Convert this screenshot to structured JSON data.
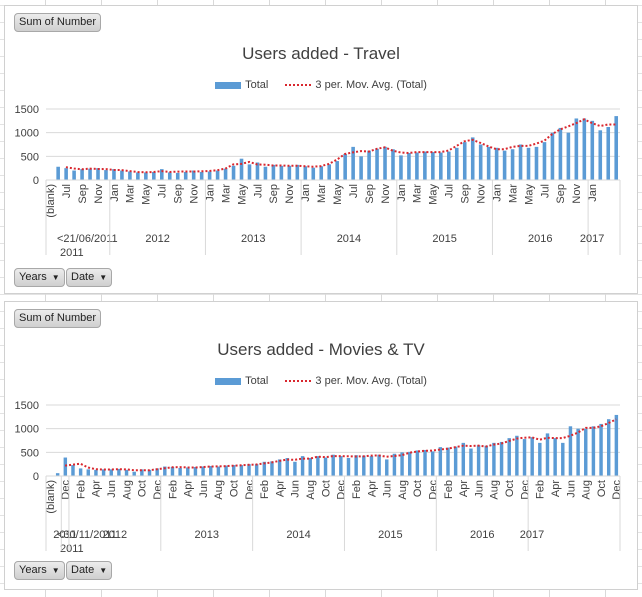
{
  "chart_data": [
    {
      "type": "bar",
      "title": "Users added - Travel",
      "field_button": "Sum of Number",
      "axis_buttons": [
        {
          "label": "Years"
        },
        {
          "label": "Date"
        }
      ],
      "legend": {
        "position": "top",
        "entries": [
          "Total",
          "3 per. Mov. Avg. (Total)"
        ]
      },
      "ylim": [
        0,
        1500
      ],
      "yticks": [
        "0",
        "500",
        "1000",
        "1500"
      ],
      "grid": true,
      "colors": {
        "bar": "#5b9bd5",
        "trend": "#d9272e"
      },
      "month_labels": [
        "(blank)",
        "",
        "Jul",
        "",
        "Sep",
        "",
        "Nov",
        "",
        "Jan",
        "",
        "Mar",
        "",
        "May",
        "",
        "Jul",
        "",
        "Sep",
        "",
        "Nov",
        "",
        "Jan",
        "",
        "Mar",
        "",
        "May",
        "",
        "Jul",
        "",
        "Sep",
        "",
        "Nov",
        "",
        "Jan",
        "",
        "Mar",
        "",
        "May",
        "",
        "Jul",
        "",
        "Sep",
        "",
        "Nov",
        "",
        "Jan",
        "",
        "Mar",
        "",
        "May",
        "",
        "Jul",
        "",
        "Sep",
        "",
        "Nov",
        "",
        "Jan",
        "",
        "Mar",
        "",
        "May",
        "",
        "Jul",
        "",
        "Sep",
        "",
        "Nov",
        "",
        "Jan"
      ],
      "year_groups": [
        {
          "label": "<21/06/2011",
          "sub": "2011",
          "span": 8
        },
        {
          "label": "2012",
          "span": 12
        },
        {
          "label": "2013",
          "span": 12
        },
        {
          "label": "2014",
          "span": 12
        },
        {
          "label": "2015",
          "span": 12
        },
        {
          "label": "2016",
          "span": 12
        },
        {
          "label": "2017",
          "span": 1
        }
      ],
      "series": [
        {
          "name": "Total",
          "values": [
            0,
            280,
            250,
            200,
            230,
            240,
            250,
            210,
            230,
            200,
            180,
            160,
            160,
            170,
            230,
            160,
            150,
            170,
            200,
            170,
            180,
            200,
            240,
            300,
            450,
            330,
            370,
            280,
            320,
            300,
            300,
            320,
            290,
            260,
            290,
            330,
            400,
            550,
            700,
            500,
            620,
            660,
            700,
            650,
            520,
            570,
            580,
            600,
            590,
            580,
            600,
            680,
            800,
            900,
            750,
            700,
            680,
            620,
            650,
            750,
            680,
            700,
            800,
            1000,
            1100,
            1000,
            1300,
            1300,
            1250,
            1050,
            1120,
            1350
          ]
        },
        {
          "name": "3 per. Mov. Avg. (Total)",
          "values": [
            null,
            null,
            270,
            243,
            227,
            240,
            233,
            230,
            213,
            210,
            187,
            170,
            163,
            170,
            187,
            170,
            177,
            180,
            180,
            183,
            190,
            207,
            240,
            330,
            340,
            383,
            327,
            323,
            307,
            307,
            300,
            303,
            290,
            280,
            293,
            340,
            430,
            550,
            583,
            610,
            600,
            660,
            690,
            620,
            580,
            570,
            590,
            590,
            590,
            590,
            623,
            720,
            817,
            850,
            783,
            710,
            650,
            650,
            700,
            720,
            720,
            770,
            830,
            970,
            1070,
            1133,
            1200,
            1283,
            1200,
            1140,
            1173,
            1173
          ]
        }
      ]
    },
    {
      "type": "bar",
      "title": "Users added - Movies & TV",
      "field_button": "Sum of Number",
      "axis_buttons": [
        {
          "label": "Years"
        },
        {
          "label": "Date"
        }
      ],
      "legend": {
        "position": "top",
        "entries": [
          "Total",
          "3 per. Mov. Avg. (Total)"
        ]
      },
      "ylim": [
        0,
        1500
      ],
      "yticks": [
        "0",
        "500",
        "1000",
        "1500"
      ],
      "grid": true,
      "colors": {
        "bar": "#5b9bd5",
        "trend": "#d9272e"
      },
      "month_labels": [
        "(blank)",
        "",
        "Dec",
        "",
        "Feb",
        "",
        "Apr",
        "",
        "Jun",
        "",
        "Aug",
        "",
        "Oct",
        "",
        "Dec",
        "",
        "Feb",
        "",
        "Apr",
        "",
        "Jun",
        "",
        "Aug",
        "",
        "Oct",
        "",
        "Dec",
        "",
        "Feb",
        "",
        "Apr",
        "",
        "Jun",
        "",
        "Aug",
        "",
        "Oct",
        "",
        "Dec",
        "",
        "Feb",
        "",
        "Apr",
        "",
        "Jun",
        "",
        "Aug",
        "",
        "Oct",
        "",
        "Dec",
        "",
        "Feb",
        "",
        "Apr",
        "",
        "Jun",
        "",
        "Aug",
        "",
        "Oct",
        "",
        "Dec",
        "",
        "Feb",
        "",
        "Apr",
        "",
        "Jun",
        "",
        "Aug",
        "",
        "Oct",
        "",
        "Dec",
        ""
      ],
      "year_groups": [
        {
          "label": "<30/11/2011",
          "sub": "2011",
          "span": 2
        },
        {
          "label": "2011",
          "span": 1
        },
        {
          "label": "2012",
          "span": 12
        },
        {
          "label": "2013",
          "span": 12
        },
        {
          "label": "2014",
          "span": 12
        },
        {
          "label": "2015",
          "span": 12
        },
        {
          "label": "2016",
          "span": 12
        },
        {
          "label": "2017",
          "span": 1
        }
      ],
      "series": [
        {
          "name": "Total",
          "values": [
            0,
            60,
            390,
            230,
            160,
            140,
            130,
            140,
            140,
            150,
            130,
            90,
            140,
            130,
            160,
            200,
            190,
            170,
            180,
            190,
            200,
            210,
            200,
            220,
            230,
            230,
            250,
            250,
            300,
            310,
            350,
            380,
            300,
            420,
            380,
            420,
            390,
            450,
            420,
            380,
            440,
            430,
            420,
            450,
            350,
            470,
            500,
            510,
            540,
            550,
            520,
            610,
            600,
            620,
            700,
            580,
            650,
            640,
            700,
            720,
            800,
            850,
            780,
            820,
            700,
            900,
            800,
            700,
            1050,
            1000,
            1000,
            1050,
            1100,
            1200,
            1290
          ]
        },
        {
          "name": "3 per. Mov. Avg. (Total)",
          "values": [
            null,
            null,
            220,
            240,
            260,
            180,
            143,
            137,
            137,
            143,
            140,
            123,
            120,
            120,
            143,
            163,
            183,
            187,
            180,
            180,
            190,
            200,
            203,
            210,
            217,
            227,
            237,
            243,
            267,
            287,
            320,
            347,
            343,
            367,
            367,
            407,
            397,
            420,
            420,
            417,
            413,
            417,
            430,
            433,
            407,
            423,
            440,
            493,
            517,
            533,
            537,
            560,
            577,
            610,
            640,
            633,
            643,
            623,
            663,
            687,
            740,
            790,
            810,
            817,
            767,
            807,
            800,
            800,
            850,
            917,
            1017,
            1017,
            1050,
            1117,
            1197
          ]
        }
      ]
    }
  ]
}
